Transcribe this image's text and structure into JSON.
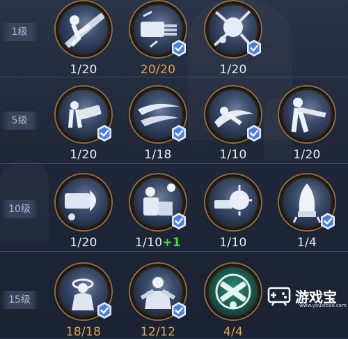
{
  "tiers": [
    {
      "label": "1级",
      "skills": [
        {
          "icon": "kick-strike-icon",
          "value": "1/20",
          "maxed": false,
          "checked": false,
          "bonus": ""
        },
        {
          "icon": "gatling-barrage-icon",
          "value": "20/20",
          "maxed": true,
          "checked": true,
          "bonus": ""
        },
        {
          "icon": "shatter-burst-icon",
          "value": "1/20",
          "maxed": false,
          "checked": true,
          "bonus": ""
        }
      ]
    },
    {
      "label": "5级",
      "skills": [
        {
          "icon": "cannon-fire-icon",
          "value": "1/20",
          "maxed": false,
          "checked": true,
          "bonus": ""
        },
        {
          "icon": "wind-slash-icon",
          "value": "1/18",
          "maxed": false,
          "checked": true,
          "bonus": ""
        },
        {
          "icon": "dash-slide-icon",
          "value": "1/10",
          "maxed": false,
          "checked": true,
          "bonus": ""
        },
        {
          "icon": "rifle-shot-icon",
          "value": "1/20",
          "maxed": false,
          "checked": false,
          "bonus": ""
        }
      ]
    },
    {
      "label": "10级",
      "skills": [
        {
          "icon": "launcher-blast-icon",
          "value": "1/20",
          "maxed": false,
          "checked": false,
          "bonus": ""
        },
        {
          "icon": "ammo-reload-icon",
          "value": "1/10",
          "maxed": false,
          "checked": true,
          "bonus": "+1"
        },
        {
          "icon": "explosion-shot-icon",
          "value": "1/10",
          "maxed": false,
          "checked": false,
          "bonus": ""
        },
        {
          "icon": "missile-drop-icon",
          "value": "1/4",
          "maxed": false,
          "checked": true,
          "bonus": ""
        }
      ]
    },
    {
      "label": "15级",
      "skills": [
        {
          "icon": "halo-charge-icon",
          "value": "18/18",
          "maxed": true,
          "checked": true,
          "bonus": ""
        },
        {
          "icon": "dual-pistol-icon",
          "value": "12/12",
          "maxed": true,
          "checked": true,
          "bonus": ""
        },
        {
          "icon": "crossed-guns-icon",
          "value": "4/4",
          "maxed": true,
          "checked": false,
          "bonus": ""
        }
      ]
    }
  ],
  "watermark": {
    "name": "游戏宝",
    "url": "www.youxibao.com"
  },
  "colors": {
    "maxed": "#e2a64a",
    "bonus": "#3ee045",
    "frame": "#8b6e45",
    "check": "#4a7fe0"
  }
}
